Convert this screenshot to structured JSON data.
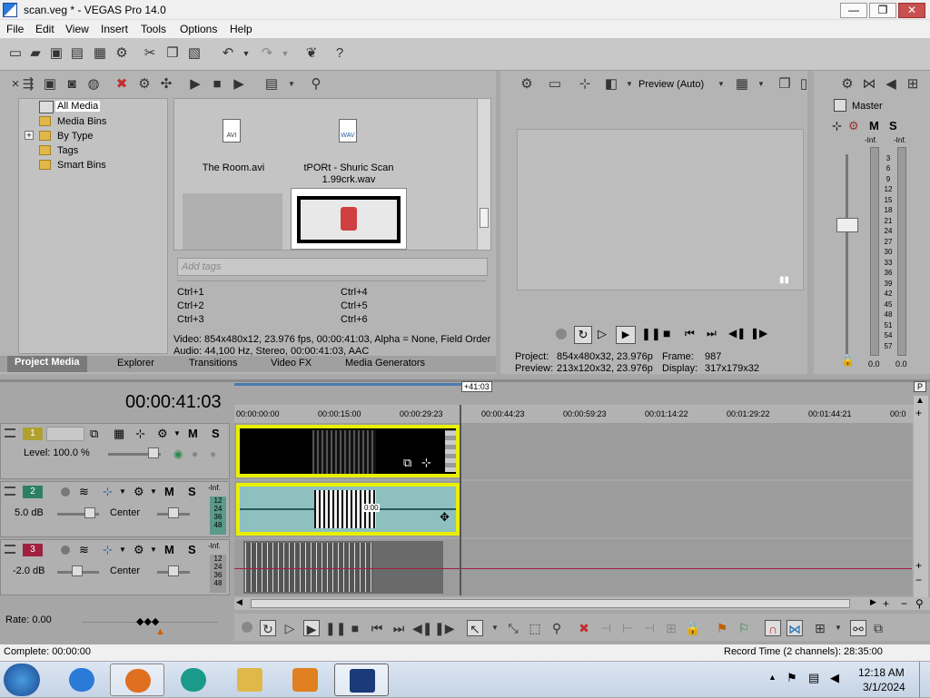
{
  "window": {
    "title": "scan.veg * - VEGAS Pro 14.0",
    "min": "—",
    "max": "❐",
    "close": "✕"
  },
  "menu": [
    "File",
    "Edit",
    "View",
    "Insert",
    "Tools",
    "Options",
    "Help"
  ],
  "media": {
    "tree": [
      "All Media",
      "Media Bins",
      "By Type",
      "Tags",
      "Smart Bins"
    ],
    "expander": "+",
    "files": [
      {
        "name": "The Room.avi",
        "type": "AVI"
      },
      {
        "name_line1": "tPORt - Shuric Scan",
        "name_line2": "1.99crk.wav",
        "type": "WAV"
      }
    ],
    "tag_placeholder": "Add tags",
    "shortcuts": [
      "Ctrl+1",
      "Ctrl+2",
      "Ctrl+3",
      "Ctrl+4",
      "Ctrl+5",
      "Ctrl+6"
    ],
    "info_video": "Video: 854x480x12, 23.976 fps, 00:00:41:03, Alpha = None, Field Order",
    "info_audio": "Audio: 44,100 Hz, Stereo, 00:00:41:03, AAC",
    "tabs": [
      "Project Media",
      "Explorer",
      "Transitions",
      "Video FX",
      "Media Generators"
    ]
  },
  "preview": {
    "mode": "Preview (Auto)",
    "project_label": "Project:",
    "project_value": "854x480x32, 23.976p",
    "preview_label": "Preview:",
    "preview_value": "213x120x32, 23.976p",
    "frame_label": "Frame:",
    "frame_value": "987",
    "display_label": "Display:",
    "display_value": "317x179x32"
  },
  "mixer": {
    "title": "Master",
    "m": "M",
    "s": "S",
    "inf": "-Inf.",
    "scale": [
      "3",
      "6",
      "9",
      "12",
      "15",
      "18",
      "21",
      "24",
      "27",
      "30",
      "33",
      "36",
      "39",
      "42",
      "45",
      "48",
      "51",
      "54",
      "57"
    ],
    "bottom_left": "0.0",
    "bottom_right": "0.0"
  },
  "timeline": {
    "timecode": "00:00:41:03",
    "marker": "+41:03",
    "ruler": [
      "00:00:00:00",
      "00:00:15:00",
      "00:00:29:23",
      "00:00:44:23",
      "00:00:59:23",
      "00:01:14:22",
      "00:01:29:22",
      "00:01:44:21",
      "00:0"
    ],
    "tracks": [
      {
        "num": "1",
        "label": "Level: 100.0 %"
      },
      {
        "num": "2",
        "vol": "5.0 dB",
        "pan": "Center"
      },
      {
        "num": "3",
        "vol": "-2.0 dB",
        "pan": "Center"
      }
    ],
    "meter_labels": [
      "-Inf.",
      "12",
      "24",
      "36",
      "48"
    ],
    "audio_clip_time": "0:00",
    "rate": "Rate: 0.00"
  },
  "status": {
    "left": "Complete: 00:00:00",
    "right": "Record Time (2 channels): 28:35:00"
  },
  "taskbar": {
    "time": "12:18 AM",
    "date": "3/1/2024"
  },
  "colors": {
    "clip_selected": "#e8f000",
    "track1": "#b0a030",
    "track2": "#2a8060",
    "track3": "#a02040"
  }
}
